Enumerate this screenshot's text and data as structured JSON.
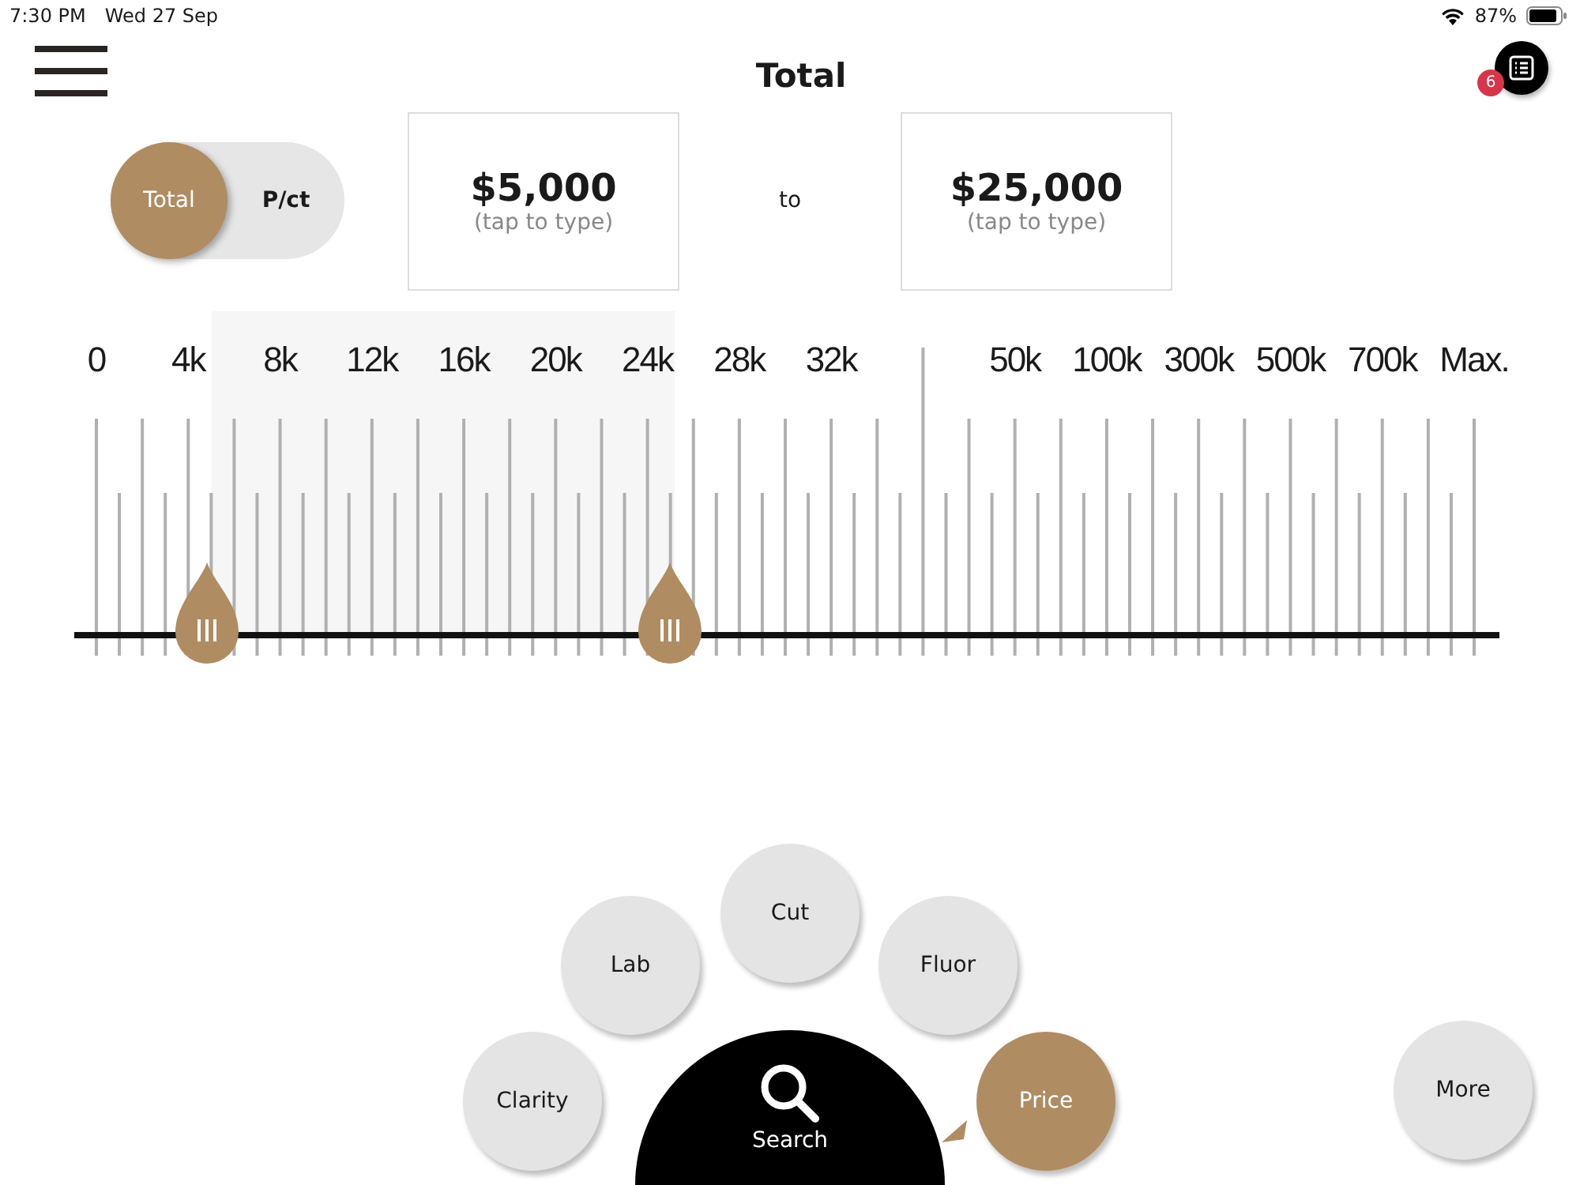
{
  "status_bar": {
    "time": "7:30 PM",
    "date": "Wed 27 Sep",
    "battery": "87%"
  },
  "title": "Total",
  "list_badge": "6",
  "mode_toggle": [
    {
      "label": "Total",
      "selected": true
    },
    {
      "label": "P/ct",
      "selected": false
    }
  ],
  "range": {
    "from": {
      "value": "$5,000",
      "hint": "(tap to type)"
    },
    "separator": "to",
    "to": {
      "value": "$25,000",
      "hint": "(tap to type)"
    }
  },
  "ruler": {
    "labels": [
      "0",
      "4k",
      "8k",
      "12k",
      "16k",
      "20k",
      "24k",
      "28k",
      "32k",
      "50k",
      "100k",
      "300k",
      "500k",
      "700k",
      "Max."
    ],
    "lower": {
      "level": 0.08
    },
    "upper": {
      "level": 0.416
    }
  },
  "filters": [
    {
      "label": "Clarity",
      "selected": false
    },
    {
      "label": "Lab",
      "selected": false
    },
    {
      "label": "Cut",
      "selected": false
    },
    {
      "label": "Fluor",
      "selected": false
    },
    {
      "label": "Price",
      "selected": true
    }
  ],
  "search_button": "Search",
  "more_button": "More"
}
